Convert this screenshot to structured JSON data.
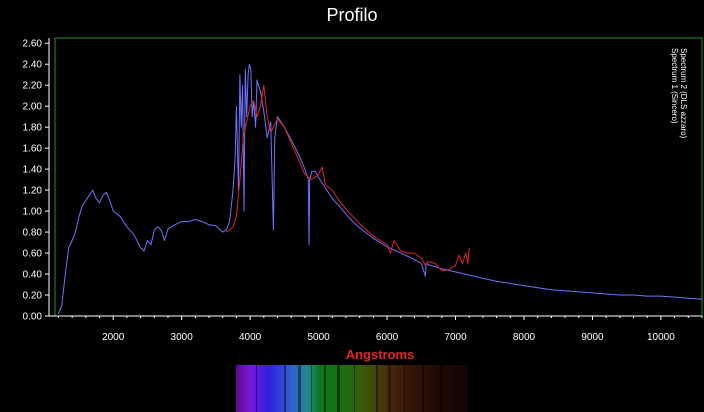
{
  "colors": {
    "background": "#000000",
    "frame": "#2e8b2e",
    "axis": "#ffffff",
    "series_blue": "#6f72ff",
    "series_red": "#e0262a",
    "xlabel": "#e0262a"
  },
  "side_labels": [
    "Spectrum 1 (Sincero)",
    "Spectrum 2 (DLS azzaro)"
  ],
  "chart_data": {
    "type": "line",
    "title": "Profilo",
    "xlabel": "Angstroms",
    "ylabel": "",
    "xlim": [
      1150,
      10600
    ],
    "ylim": [
      0,
      2.65
    ],
    "xticks": [
      2000,
      3000,
      4000,
      5000,
      6000,
      7000,
      8000,
      9000,
      10000
    ],
    "yticks": [
      0.0,
      0.2,
      0.4,
      0.6,
      0.8,
      1.0,
      1.2,
      1.4,
      1.6,
      1.8,
      2.0,
      2.2,
      2.4,
      2.6
    ],
    "ytick_labels": [
      "0.00",
      "0.20",
      "0.40",
      "0.60",
      "0.80",
      "1.00",
      "1.20",
      "1.40",
      "1.60",
      "1.80",
      "2.00",
      "2.20",
      "2.40",
      "2.60"
    ],
    "grid": false,
    "series": [
      {
        "color": "#6f72ff",
        "x": [
          1200,
          1250,
          1300,
          1350,
          1400,
          1450,
          1500,
          1550,
          1600,
          1650,
          1700,
          1750,
          1800,
          1850,
          1900,
          1950,
          2000,
          2100,
          2200,
          2300,
          2400,
          2450,
          2500,
          2550,
          2600,
          2650,
          2700,
          2750,
          2800,
          2900,
          3000,
          3100,
          3200,
          3300,
          3400,
          3500,
          3600,
          3650,
          3700,
          3750,
          3780,
          3800,
          3830,
          3850,
          3870,
          3890,
          3910,
          3930,
          3950,
          3970,
          3990,
          4010,
          4030,
          4050,
          4080,
          4100,
          4120,
          4150,
          4200,
          4250,
          4300,
          4340,
          4360,
          4400,
          4450,
          4500,
          4600,
          4700,
          4800,
          4850,
          4860,
          4870,
          4900,
          4950,
          5000,
          5100,
          5200,
          5300,
          5400,
          5500,
          5600,
          5800,
          6000,
          6200,
          6400,
          6500,
          6560,
          6570,
          6600,
          6800,
          7000,
          7200,
          7400,
          7600,
          7800,
          8000,
          8200,
          8400,
          8600,
          8800,
          9000,
          9200,
          9400,
          9600,
          9800,
          10000,
          10200,
          10400,
          10600
        ],
        "y": [
          0.02,
          0.1,
          0.4,
          0.65,
          0.72,
          0.8,
          0.95,
          1.05,
          1.1,
          1.15,
          1.2,
          1.12,
          1.08,
          1.15,
          1.18,
          1.1,
          1.0,
          0.95,
          0.85,
          0.78,
          0.65,
          0.62,
          0.72,
          0.68,
          0.82,
          0.85,
          0.82,
          0.72,
          0.83,
          0.87,
          0.9,
          0.9,
          0.92,
          0.9,
          0.87,
          0.86,
          0.8,
          0.82,
          0.9,
          1.2,
          1.5,
          2.0,
          1.2,
          2.3,
          1.8,
          2.2,
          1.0,
          2.35,
          1.9,
          2.3,
          2.4,
          2.35,
          1.9,
          2.05,
          1.8,
          2.25,
          2.2,
          2.15,
          1.95,
          1.7,
          1.85,
          0.82,
          1.7,
          1.9,
          1.85,
          1.8,
          1.68,
          1.55,
          1.4,
          1.3,
          0.68,
          1.3,
          1.38,
          1.38,
          1.32,
          1.22,
          1.12,
          1.05,
          0.97,
          0.9,
          0.84,
          0.74,
          0.66,
          0.6,
          0.54,
          0.5,
          0.38,
          0.5,
          0.49,
          0.45,
          0.42,
          0.39,
          0.36,
          0.33,
          0.31,
          0.29,
          0.27,
          0.25,
          0.24,
          0.23,
          0.22,
          0.21,
          0.2,
          0.2,
          0.19,
          0.19,
          0.18,
          0.17,
          0.16
        ]
      },
      {
        "color": "#e0262a",
        "x": [
          3650,
          3700,
          3750,
          3800,
          3850,
          3900,
          3950,
          4000,
          4050,
          4100,
          4150,
          4200,
          4250,
          4300,
          4400,
          4500,
          4600,
          4700,
          4800,
          4900,
          5000,
          5050,
          5100,
          5200,
          5300,
          5400,
          5500,
          5600,
          5700,
          5800,
          5900,
          6000,
          6050,
          6100,
          6200,
          6300,
          6400,
          6500,
          6560,
          6600,
          6700,
          6800,
          6900,
          7000,
          7050,
          7100,
          7150,
          7180,
          7200
        ],
        "y": [
          0.8,
          0.82,
          0.85,
          0.95,
          1.3,
          1.7,
          1.85,
          2.0,
          2.05,
          1.9,
          2.0,
          2.2,
          1.9,
          1.75,
          1.88,
          1.8,
          1.65,
          1.5,
          1.35,
          1.3,
          1.35,
          1.42,
          1.25,
          1.2,
          1.1,
          1.02,
          0.95,
          0.88,
          0.82,
          0.76,
          0.72,
          0.68,
          0.6,
          0.72,
          0.62,
          0.6,
          0.6,
          0.55,
          0.48,
          0.52,
          0.5,
          0.43,
          0.44,
          0.48,
          0.58,
          0.5,
          0.6,
          0.5,
          0.65
        ]
      }
    ]
  }
}
